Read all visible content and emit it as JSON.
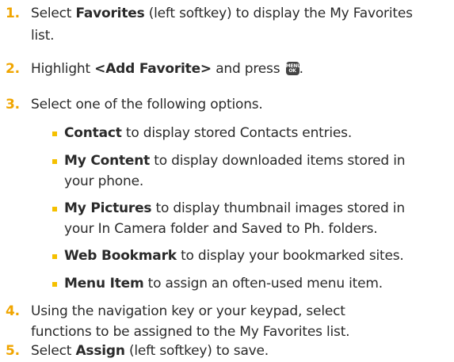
{
  "colors": {
    "number": "#f0a500",
    "bullet": "#f5c000",
    "text": "#2a2a2a"
  },
  "steps": [
    {
      "num": "1.",
      "lines": [
        {
          "b": "",
          "pre": "Select ",
          "bold": "Favorites",
          "post": " (left softkey) to display the My Favorites"
        },
        {
          "post": "list."
        }
      ]
    },
    {
      "num": "2.",
      "pre": "Highlight ",
      "bold": "<Add Favorite>",
      "post": " and press",
      "key_top": "MENU",
      "key_bottom": "OK",
      "end": "."
    },
    {
      "num": "3.",
      "text": "Select one of the following options."
    },
    {
      "num": "4.",
      "lines": [
        "Using the navigation key or your keypad, select",
        "functions to be assigned to the My Favorites list."
      ]
    },
    {
      "num": "5.",
      "pre": "Select ",
      "bold": "Assign",
      "post": " (left softkey) to save."
    }
  ],
  "options": [
    {
      "bold": "Contact",
      "lines": [
        " to display stored Contacts entries."
      ]
    },
    {
      "bold": "My Content",
      "lines": [
        " to display downloaded items stored in",
        "your phone."
      ]
    },
    {
      "bold": "My Pictures",
      "lines": [
        " to display thumbnail images stored in",
        "your In Camera folder and Saved to Ph. folders."
      ]
    },
    {
      "bold": "Web Bookmark",
      "lines": [
        " to display your bookmarked sites."
      ]
    },
    {
      "bold": "Menu Item",
      "lines": [
        " to assign an often-used menu item."
      ]
    }
  ]
}
